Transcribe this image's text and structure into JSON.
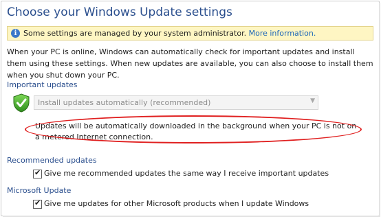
{
  "title": "Choose your Windows Update settings",
  "info_bar": {
    "icon": "info-icon",
    "text": "Some settings are managed by your system administrator.",
    "link": "More information."
  },
  "intro": "When your PC is online, Windows can automatically check for important updates and install them using these settings. When new updates are available, you can also choose to install them when you shut down your PC.",
  "important_updates": {
    "heading": "Important updates",
    "icon": "shield-check-icon",
    "dropdown_value": "Install updates automatically (recommended)",
    "description": "Updates will be automatically downloaded in the background when your PC is not on a metered Internet connection."
  },
  "recommended_updates": {
    "heading": "Recommended updates",
    "checkbox_label": "Give me recommended updates the same way I receive important updates",
    "checked": true
  },
  "microsoft_update": {
    "heading": "Microsoft Update",
    "checkbox_label": "Give me updates for other Microsoft products when I update Windows",
    "checked": true
  },
  "colors": {
    "heading": "#2b4f8e",
    "link": "#1a64b8",
    "info_bar_bg": "#fef6c3",
    "highlight_oval": "#e02020"
  }
}
